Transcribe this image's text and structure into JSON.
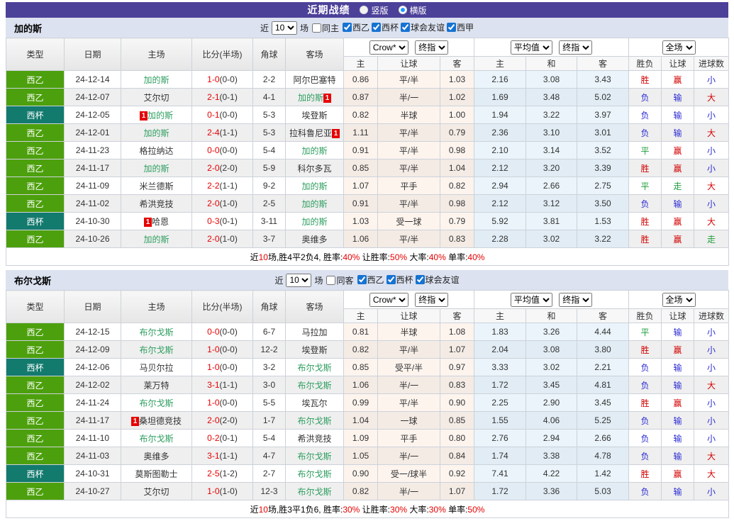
{
  "header": {
    "title": "近期战绩",
    "vertical_label": "竖版",
    "horizontal_label": "横版"
  },
  "columns": {
    "type": "类型",
    "date": "日期",
    "home": "主场",
    "score": "比分(半场)",
    "corner": "角球",
    "away": "客场",
    "h_home": "主",
    "h_line": "让球",
    "h_away": "客",
    "a_home": "主",
    "a_draw": "和",
    "a_away": "客",
    "result": "胜负",
    "r_handicap": "让球",
    "r_goals": "进球数"
  },
  "selects": {
    "bookmaker": "Crow*",
    "stage": "终指",
    "average": "平均值",
    "stage2": "终指",
    "full": "全场"
  },
  "colors": {
    "header_purple": "#4C4199",
    "league_green": "#4DA00D",
    "cup_teal": "#137A6E",
    "team_highlight_green": "#2E9E60",
    "score_red": "#E60000",
    "win_red": "#D40000",
    "lose_blue": "#2B2BD5",
    "draw_green": "#1D9E3B",
    "crow_col_bg": "#FDF4EE",
    "avg_col_bg": "#EAF4FA",
    "badge_red": "#E60000",
    "filter_bar_bg": "#DCE2F0"
  },
  "tables": [
    {
      "team": "加的斯",
      "filter": {
        "near": "近",
        "count": "10",
        "unit": "场",
        "same": "同主",
        "leagues": [
          "西乙",
          "西杯",
          "球会友谊",
          "西甲"
        ]
      },
      "rows": [
        {
          "type": "西乙",
          "cup": false,
          "date": "24-12-14",
          "hb": "",
          "home": "加的斯",
          "hg": true,
          "ha": "",
          "score": "1-0",
          "half": "(0-0)",
          "corner": "2-2",
          "ab": "",
          "away": "阿尔巴塞特",
          "ag": false,
          "aa": "",
          "crow": [
            "0.86",
            "平/半",
            "1.03"
          ],
          "avg": [
            "2.16",
            "3.08",
            "3.43"
          ],
          "res": [
            "胜",
            "cr"
          ],
          "hcp": [
            "赢",
            "cr"
          ],
          "gls": [
            "小",
            "cb"
          ]
        },
        {
          "type": "西乙",
          "cup": false,
          "date": "24-12-07",
          "hb": "",
          "home": "艾尔切",
          "hg": false,
          "ha": "",
          "score": "2-1",
          "half": "(0-1)",
          "corner": "4-1",
          "ab": "",
          "away": "加的斯",
          "ag": true,
          "aa": "1",
          "crow": [
            "0.87",
            "半/一",
            "1.02"
          ],
          "avg": [
            "1.69",
            "3.48",
            "5.02"
          ],
          "res": [
            "负",
            "cb"
          ],
          "hcp": [
            "输",
            "cb"
          ],
          "gls": [
            "大",
            "cr"
          ]
        },
        {
          "type": "西杯",
          "cup": true,
          "date": "24-12-05",
          "hb": "1",
          "home": "加的斯",
          "hg": true,
          "ha": "",
          "score": "0-1",
          "half": "(0-0)",
          "corner": "5-3",
          "ab": "",
          "away": "埃登斯",
          "ag": false,
          "aa": "",
          "crow": [
            "0.82",
            "半球",
            "1.00"
          ],
          "avg": [
            "1.94",
            "3.22",
            "3.97"
          ],
          "res": [
            "负",
            "cb"
          ],
          "hcp": [
            "输",
            "cb"
          ],
          "gls": [
            "小",
            "cb"
          ]
        },
        {
          "type": "西乙",
          "cup": false,
          "date": "24-12-01",
          "hb": "",
          "home": "加的斯",
          "hg": true,
          "ha": "",
          "score": "2-4",
          "half": "(1-1)",
          "corner": "5-3",
          "ab": "",
          "away": "拉科鲁尼亚",
          "ag": false,
          "aa": "1",
          "crow": [
            "1.11",
            "平/半",
            "0.79"
          ],
          "avg": [
            "2.36",
            "3.10",
            "3.01"
          ],
          "res": [
            "负",
            "cb"
          ],
          "hcp": [
            "输",
            "cb"
          ],
          "gls": [
            "大",
            "cr"
          ]
        },
        {
          "type": "西乙",
          "cup": false,
          "date": "24-11-23",
          "hb": "",
          "home": "格拉纳达",
          "hg": false,
          "ha": "",
          "score": "0-0",
          "half": "(0-0)",
          "corner": "5-4",
          "ab": "",
          "away": "加的斯",
          "ag": true,
          "aa": "",
          "crow": [
            "0.91",
            "平/半",
            "0.98"
          ],
          "avg": [
            "2.10",
            "3.14",
            "3.52"
          ],
          "res": [
            "平",
            "cg"
          ],
          "hcp": [
            "赢",
            "cr"
          ],
          "gls": [
            "小",
            "cb"
          ]
        },
        {
          "type": "西乙",
          "cup": false,
          "date": "24-11-17",
          "hb": "",
          "home": "加的斯",
          "hg": true,
          "ha": "",
          "score": "2-0",
          "half": "(2-0)",
          "corner": "5-9",
          "ab": "",
          "away": "科尔多瓦",
          "ag": false,
          "aa": "",
          "crow": [
            "0.85",
            "平/半",
            "1.04"
          ],
          "avg": [
            "2.12",
            "3.20",
            "3.39"
          ],
          "res": [
            "胜",
            "cr"
          ],
          "hcp": [
            "赢",
            "cr"
          ],
          "gls": [
            "小",
            "cb"
          ]
        },
        {
          "type": "西乙",
          "cup": false,
          "date": "24-11-09",
          "hb": "",
          "home": "米兰德斯",
          "hg": false,
          "ha": "",
          "score": "2-2",
          "half": "(1-1)",
          "corner": "9-2",
          "ab": "",
          "away": "加的斯",
          "ag": true,
          "aa": "",
          "crow": [
            "1.07",
            "平手",
            "0.82"
          ],
          "avg": [
            "2.94",
            "2.66",
            "2.75"
          ],
          "res": [
            "平",
            "cg"
          ],
          "hcp": [
            "走",
            "cg"
          ],
          "gls": [
            "大",
            "cr"
          ]
        },
        {
          "type": "西乙",
          "cup": false,
          "date": "24-11-02",
          "hb": "",
          "home": "希洪竞技",
          "hg": false,
          "ha": "",
          "score": "2-0",
          "half": "(1-0)",
          "corner": "2-5",
          "ab": "",
          "away": "加的斯",
          "ag": true,
          "aa": "",
          "crow": [
            "0.91",
            "平/半",
            "0.98"
          ],
          "avg": [
            "2.12",
            "3.12",
            "3.50"
          ],
          "res": [
            "负",
            "cb"
          ],
          "hcp": [
            "输",
            "cb"
          ],
          "gls": [
            "小",
            "cb"
          ]
        },
        {
          "type": "西杯",
          "cup": true,
          "date": "24-10-30",
          "hb": "1",
          "home": "哈恩",
          "hg": false,
          "ha": "",
          "score": "0-3",
          "half": "(0-1)",
          "corner": "3-11",
          "ab": "",
          "away": "加的斯",
          "ag": true,
          "aa": "",
          "crow": [
            "1.03",
            "受一球",
            "0.79"
          ],
          "avg": [
            "5.92",
            "3.81",
            "1.53"
          ],
          "res": [
            "胜",
            "cr"
          ],
          "hcp": [
            "赢",
            "cr"
          ],
          "gls": [
            "大",
            "cr"
          ]
        },
        {
          "type": "西乙",
          "cup": false,
          "date": "24-10-26",
          "hb": "",
          "home": "加的斯",
          "hg": true,
          "ha": "",
          "score": "2-0",
          "half": "(1-0)",
          "corner": "3-7",
          "ab": "",
          "away": "奥维多",
          "ag": false,
          "aa": "",
          "crow": [
            "1.06",
            "平/半",
            "0.83"
          ],
          "avg": [
            "2.28",
            "3.02",
            "3.22"
          ],
          "res": [
            "胜",
            "cr"
          ],
          "hcp": [
            "赢",
            "cr"
          ],
          "gls": [
            "走",
            "cg"
          ]
        }
      ],
      "summary": [
        {
          "t": "近",
          "red": false
        },
        {
          "t": "10",
          "red": true
        },
        {
          "t": "场,胜4平2负4, 胜率:",
          "red": false
        },
        {
          "t": "40%",
          "red": true
        },
        {
          "t": " 让胜率:",
          "red": false
        },
        {
          "t": "50%",
          "red": true
        },
        {
          "t": " 大率:",
          "red": false
        },
        {
          "t": "40%",
          "red": true
        },
        {
          "t": " 单率:",
          "red": false
        },
        {
          "t": "40%",
          "red": true
        }
      ]
    },
    {
      "team": "布尔戈斯",
      "filter": {
        "near": "近",
        "count": "10",
        "unit": "场",
        "same": "同客",
        "leagues": [
          "西乙",
          "西杯",
          "球会友谊"
        ]
      },
      "rows": [
        {
          "type": "西乙",
          "cup": false,
          "date": "24-12-15",
          "hb": "",
          "home": "布尔戈斯",
          "hg": true,
          "ha": "",
          "score": "0-0",
          "half": "(0-0)",
          "corner": "6-7",
          "ab": "",
          "away": "马拉加",
          "ag": false,
          "aa": "",
          "crow": [
            "0.81",
            "半球",
            "1.08"
          ],
          "avg": [
            "1.83",
            "3.26",
            "4.44"
          ],
          "res": [
            "平",
            "cg"
          ],
          "hcp": [
            "输",
            "cb"
          ],
          "gls": [
            "小",
            "cb"
          ]
        },
        {
          "type": "西乙",
          "cup": false,
          "date": "24-12-09",
          "hb": "",
          "home": "布尔戈斯",
          "hg": true,
          "ha": "",
          "score": "1-0",
          "half": "(0-0)",
          "corner": "12-2",
          "ab": "",
          "away": "埃登斯",
          "ag": false,
          "aa": "",
          "crow": [
            "0.82",
            "平/半",
            "1.07"
          ],
          "avg": [
            "2.04",
            "3.08",
            "3.80"
          ],
          "res": [
            "胜",
            "cr"
          ],
          "hcp": [
            "赢",
            "cr"
          ],
          "gls": [
            "小",
            "cb"
          ]
        },
        {
          "type": "西杯",
          "cup": true,
          "date": "24-12-06",
          "hb": "",
          "home": "马贝尔拉",
          "hg": false,
          "ha": "",
          "score": "1-0",
          "half": "(0-0)",
          "corner": "3-2",
          "ab": "",
          "away": "布尔戈斯",
          "ag": true,
          "aa": "",
          "crow": [
            "0.85",
            "受平/半",
            "0.97"
          ],
          "avg": [
            "3.33",
            "3.02",
            "2.21"
          ],
          "res": [
            "负",
            "cb"
          ],
          "hcp": [
            "输",
            "cb"
          ],
          "gls": [
            "小",
            "cb"
          ]
        },
        {
          "type": "西乙",
          "cup": false,
          "date": "24-12-02",
          "hb": "",
          "home": "莱万特",
          "hg": false,
          "ha": "",
          "score": "3-1",
          "half": "(1-1)",
          "corner": "3-0",
          "ab": "",
          "away": "布尔戈斯",
          "ag": true,
          "aa": "",
          "crow": [
            "1.06",
            "半/一",
            "0.83"
          ],
          "avg": [
            "1.72",
            "3.45",
            "4.81"
          ],
          "res": [
            "负",
            "cb"
          ],
          "hcp": [
            "输",
            "cb"
          ],
          "gls": [
            "大",
            "cr"
          ]
        },
        {
          "type": "西乙",
          "cup": false,
          "date": "24-11-24",
          "hb": "",
          "home": "布尔戈斯",
          "hg": true,
          "ha": "",
          "score": "1-0",
          "half": "(0-0)",
          "corner": "5-5",
          "ab": "",
          "away": "埃瓦尔",
          "ag": false,
          "aa": "",
          "crow": [
            "0.99",
            "平/半",
            "0.90"
          ],
          "avg": [
            "2.25",
            "2.90",
            "3.45"
          ],
          "res": [
            "胜",
            "cr"
          ],
          "hcp": [
            "赢",
            "cr"
          ],
          "gls": [
            "小",
            "cb"
          ]
        },
        {
          "type": "西乙",
          "cup": false,
          "date": "24-11-17",
          "hb": "1",
          "home": "桑坦德竞技",
          "hg": false,
          "ha": "",
          "score": "2-0",
          "half": "(2-0)",
          "corner": "1-7",
          "ab": "",
          "away": "布尔戈斯",
          "ag": true,
          "aa": "",
          "crow": [
            "1.04",
            "一球",
            "0.85"
          ],
          "avg": [
            "1.55",
            "4.06",
            "5.25"
          ],
          "res": [
            "负",
            "cb"
          ],
          "hcp": [
            "输",
            "cb"
          ],
          "gls": [
            "小",
            "cb"
          ]
        },
        {
          "type": "西乙",
          "cup": false,
          "date": "24-11-10",
          "hb": "",
          "home": "布尔戈斯",
          "hg": true,
          "ha": "",
          "score": "0-2",
          "half": "(0-1)",
          "corner": "5-4",
          "ab": "",
          "away": "希洪竞技",
          "ag": false,
          "aa": "",
          "crow": [
            "1.09",
            "平手",
            "0.80"
          ],
          "avg": [
            "2.76",
            "2.94",
            "2.66"
          ],
          "res": [
            "负",
            "cb"
          ],
          "hcp": [
            "输",
            "cb"
          ],
          "gls": [
            "小",
            "cb"
          ]
        },
        {
          "type": "西乙",
          "cup": false,
          "date": "24-11-03",
          "hb": "",
          "home": "奥维多",
          "hg": false,
          "ha": "",
          "score": "3-1",
          "half": "(1-1)",
          "corner": "4-7",
          "ab": "",
          "away": "布尔戈斯",
          "ag": true,
          "aa": "",
          "crow": [
            "1.05",
            "半/一",
            "0.84"
          ],
          "avg": [
            "1.74",
            "3.38",
            "4.78"
          ],
          "res": [
            "负",
            "cb"
          ],
          "hcp": [
            "输",
            "cb"
          ],
          "gls": [
            "大",
            "cr"
          ]
        },
        {
          "type": "西杯",
          "cup": true,
          "date": "24-10-31",
          "hb": "",
          "home": "莫斯图勒士",
          "hg": false,
          "ha": "",
          "score": "2-5",
          "half": "(1-2)",
          "corner": "2-7",
          "ab": "",
          "away": "布尔戈斯",
          "ag": true,
          "aa": "",
          "crow": [
            "0.90",
            "受一/球半",
            "0.92"
          ],
          "avg": [
            "7.41",
            "4.22",
            "1.42"
          ],
          "res": [
            "胜",
            "cr"
          ],
          "hcp": [
            "赢",
            "cr"
          ],
          "gls": [
            "大",
            "cr"
          ]
        },
        {
          "type": "西乙",
          "cup": false,
          "date": "24-10-27",
          "hb": "",
          "home": "艾尔切",
          "hg": false,
          "ha": "",
          "score": "1-0",
          "half": "(1-0)",
          "corner": "12-3",
          "ab": "",
          "away": "布尔戈斯",
          "ag": true,
          "aa": "",
          "crow": [
            "0.82",
            "半/一",
            "1.07"
          ],
          "avg": [
            "1.72",
            "3.36",
            "5.03"
          ],
          "res": [
            "负",
            "cb"
          ],
          "hcp": [
            "输",
            "cb"
          ],
          "gls": [
            "小",
            "cb"
          ]
        }
      ],
      "summary": [
        {
          "t": "近",
          "red": false
        },
        {
          "t": "10",
          "red": true
        },
        {
          "t": "场,胜3平1负6, 胜率:",
          "red": false
        },
        {
          "t": "30%",
          "red": true
        },
        {
          "t": " 让胜率:",
          "red": false
        },
        {
          "t": "30%",
          "red": true
        },
        {
          "t": " 大率:",
          "red": false
        },
        {
          "t": "30%",
          "red": true
        },
        {
          "t": " 单率:",
          "red": false
        },
        {
          "t": "50%",
          "red": true
        }
      ]
    }
  ]
}
